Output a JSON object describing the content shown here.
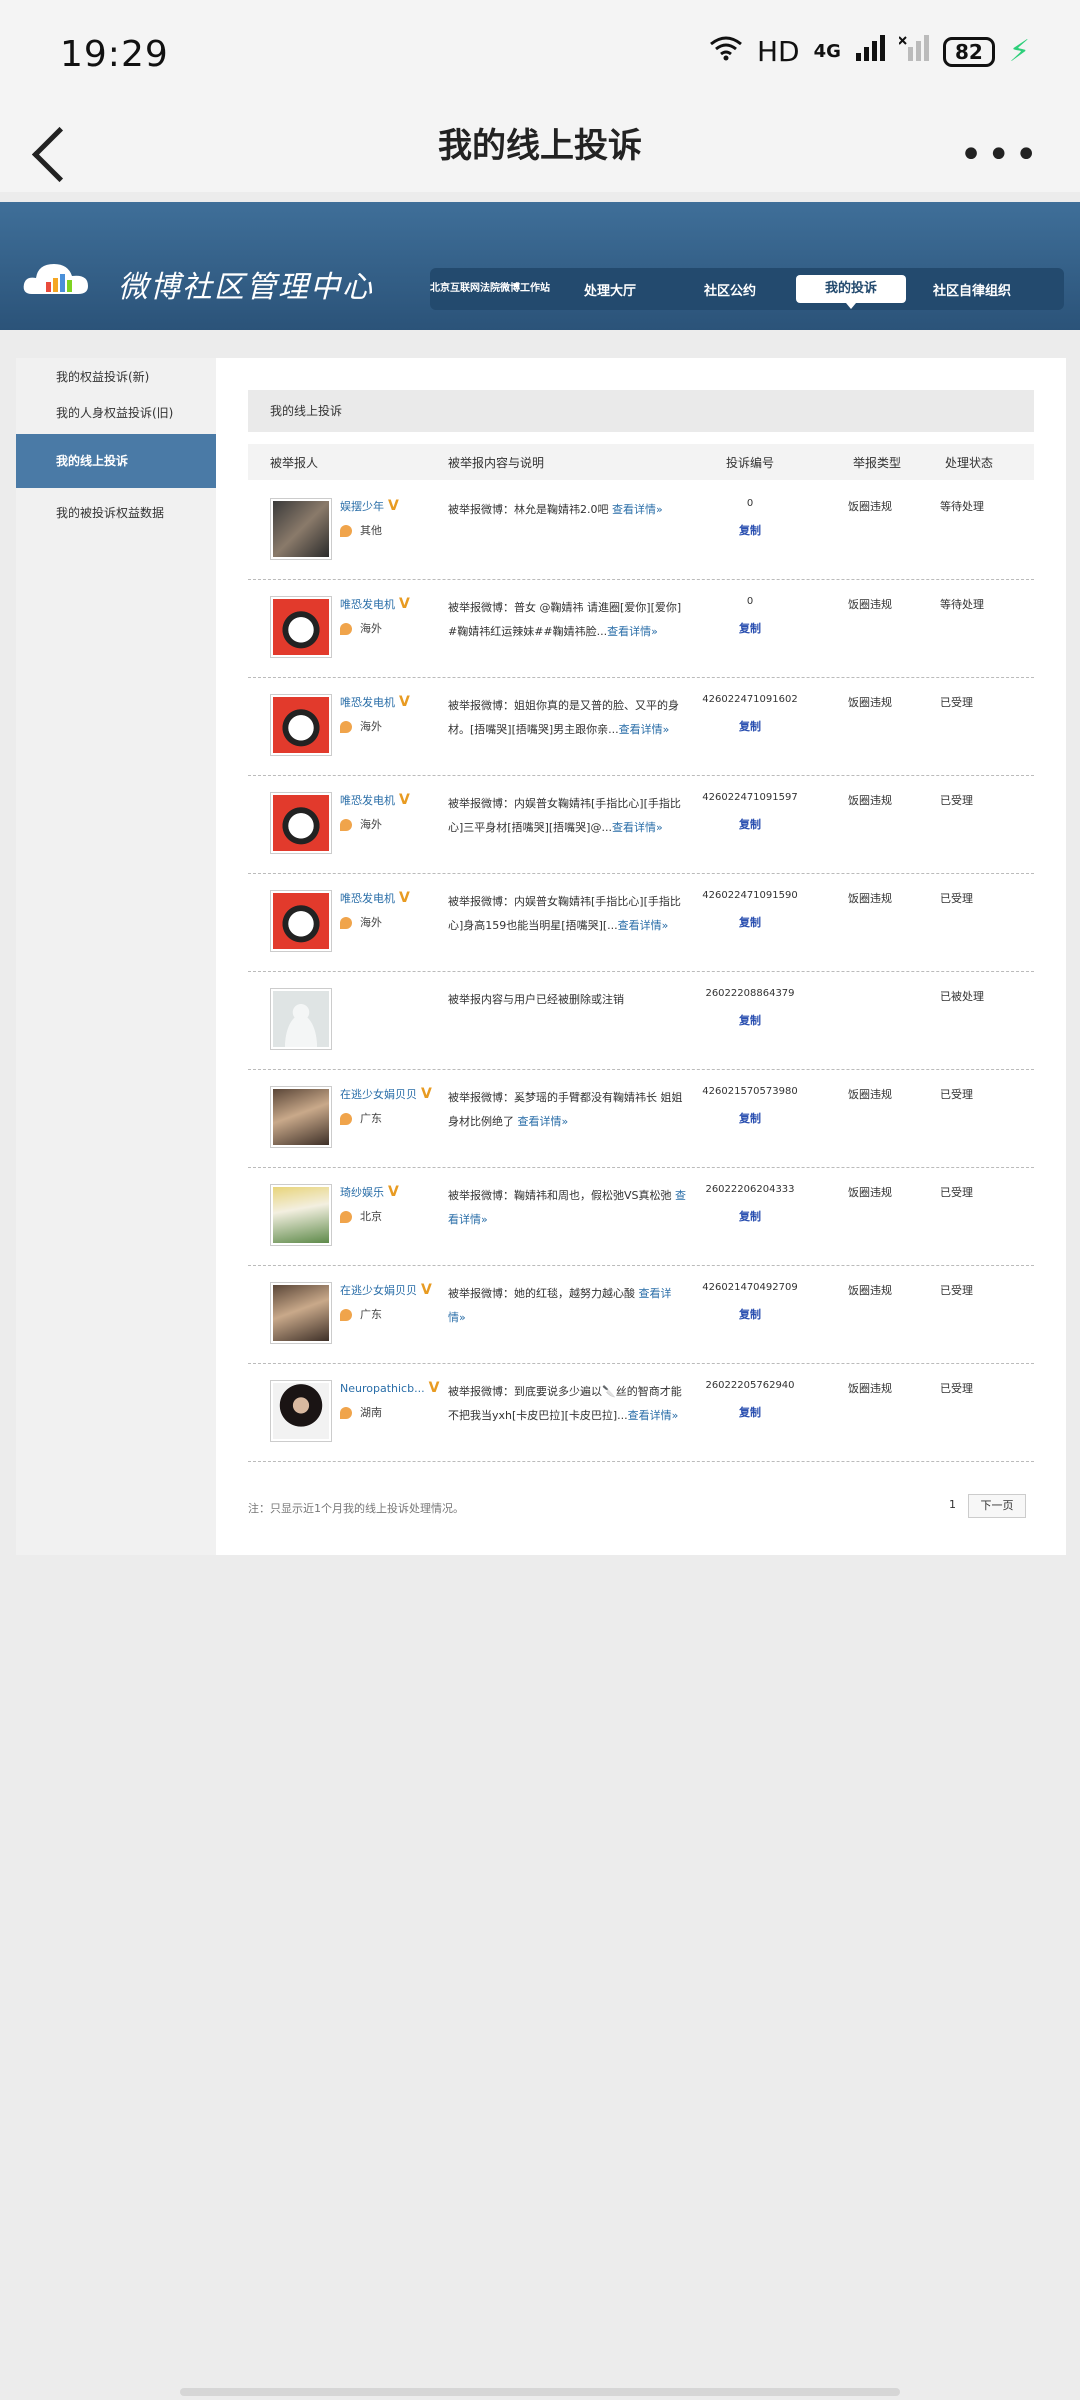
{
  "status_bar": {
    "time": "19:29",
    "network": "HD",
    "signal": "4G",
    "battery": "82"
  },
  "app_bar": {
    "title": "我的线上投诉"
  },
  "header": {
    "site_title": "微博社区管理中心",
    "nav": [
      {
        "label": "北京互联网法院微博工作站"
      },
      {
        "label": "处理大厅"
      },
      {
        "label": "社区公约"
      },
      {
        "label": "我的投诉"
      },
      {
        "label": "社区自律组织"
      }
    ]
  },
  "sidebar": {
    "items": [
      {
        "label": "我的权益投诉(新)"
      },
      {
        "label": "我的人身权益投诉(旧)"
      },
      {
        "label": "我的线上投诉"
      },
      {
        "label": "我的被投诉权益数据"
      }
    ]
  },
  "main": {
    "section_title": "我的线上投诉",
    "columns": [
      "被举报人",
      "被举报内容与说明",
      "投诉编号",
      "举报类型",
      "处理状态"
    ],
    "rows": [
      {
        "user": "娱摆少年",
        "location": "其他",
        "desc": "被举报微博：林允是鞠婧祎2.0吧 ",
        "link": "查看详情»",
        "number": "0",
        "copy": "复制",
        "type": "饭圈违规",
        "status": "等待处理"
      },
      {
        "user": "唯恐发电机",
        "location": "海外",
        "desc": "被举报微博：普女 @鞠婧祎 请進圈[爱你][爱你] #鞠婧祎红运辣妹##鞠婧祎脸...",
        "link": "查看详情»",
        "number": "0",
        "copy": "复制",
        "type": "饭圈违规",
        "status": "等待处理"
      },
      {
        "user": "唯恐发电机",
        "location": "海外",
        "desc": "被举报微博：姐姐你真的是又普的脸、又平的身材。[捂嘴哭][捂嘴哭]男主跟你亲...",
        "link": "查看详情»",
        "number": "426022471091602",
        "copy": "复制",
        "type": "饭圈违规",
        "status": "已受理"
      },
      {
        "user": "唯恐发电机",
        "location": "海外",
        "desc": "被举报微博：内娱普女鞠婧祎[手指比心][手指比心]三平身材[捂嘴哭][捂嘴哭]@...",
        "link": "查看详情»",
        "number": "426022471091597",
        "copy": "复制",
        "type": "饭圈违规",
        "status": "已受理"
      },
      {
        "user": "唯恐发电机",
        "location": "海外",
        "desc": "被举报微博：内娱普女鞠婧祎[手指比心][手指比心]身高159也能当明星[捂嘴哭][...",
        "link": "查看详情»",
        "number": "426022471091590",
        "copy": "复制",
        "type": "饭圈违规",
        "status": "已受理"
      },
      {
        "user": "",
        "location": "",
        "desc": "被举报内容与用户已经被删除或注销",
        "link": "",
        "number": "26022208864379",
        "copy": "复制",
        "type": "",
        "status": "已被处理"
      },
      {
        "user": "在逃少女娟贝贝",
        "location": "广东",
        "desc": "被举报微博：奚梦瑶的手臂都没有鞠婧祎长 姐姐身材比例绝了 ",
        "link": "查看详情»",
        "number": "426021570573980",
        "copy": "复制",
        "type": "饭圈违规",
        "status": "已受理"
      },
      {
        "user": "琦纱娱乐",
        "location": "北京",
        "desc": "被举报微博：鞠婧祎和周也，假松弛VS真松弛 ",
        "link": "查看详情»",
        "number": "26022206204333",
        "copy": "复制",
        "type": "饭圈违规",
        "status": "已受理"
      },
      {
        "user": "在逃少女娟贝贝",
        "location": "广东",
        "desc": "被举报微博：她的红毯，越努力越心酸 ",
        "link": "查看详情»",
        "number": "426021470492709",
        "copy": "复制",
        "type": "饭圈违规",
        "status": "已受理"
      },
      {
        "user": "Neuropathicb...",
        "location": "湖南",
        "desc": "被举报微博：到底要说多少遍以🔪丝的智商才能不把我当yxh[卡皮巴拉][卡皮巴拉]...",
        "link": "查看详情»",
        "number": "26022205762940",
        "copy": "复制",
        "type": "饭圈违规",
        "status": "已受理"
      }
    ],
    "note": "注：只显示近1个月我的线上投诉处理情况。",
    "pager": {
      "page": "1",
      "next": "下一页"
    }
  }
}
